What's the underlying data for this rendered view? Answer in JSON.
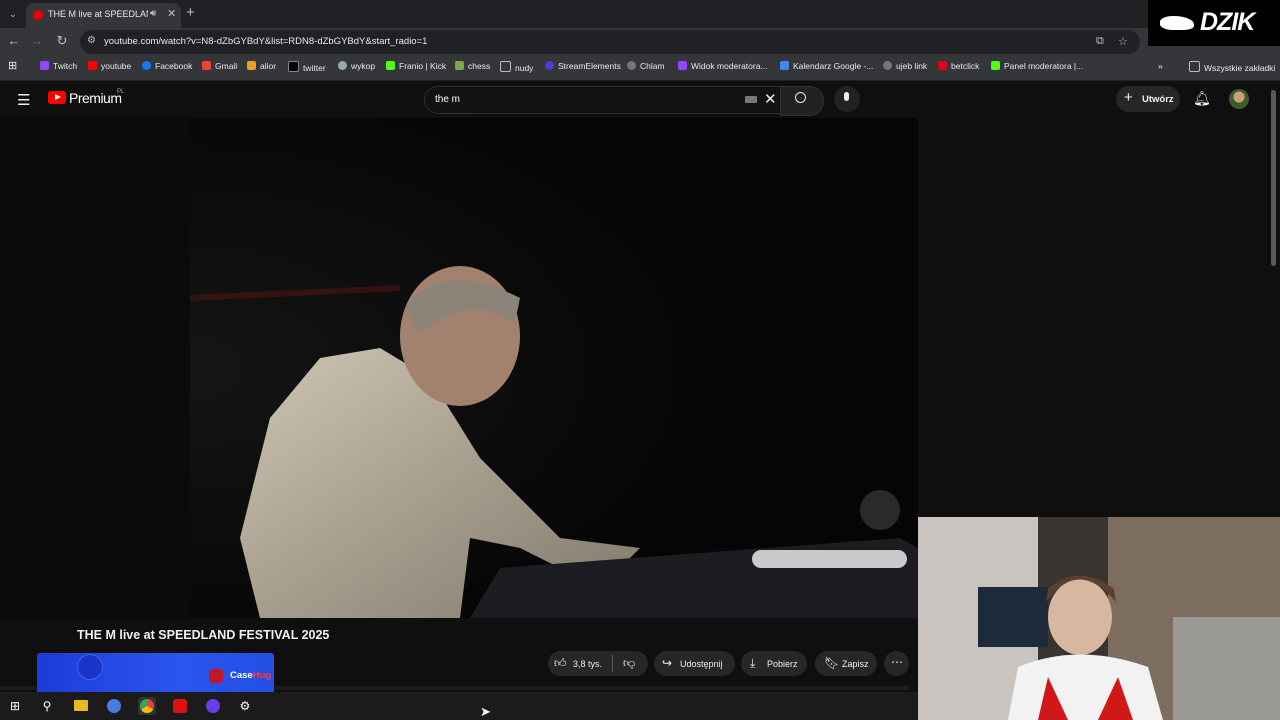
{
  "browser": {
    "tab_title": "THE M live at SPEEDLAND F",
    "url": "youtube.com/watch?v=N8-dZbGYBdY&list=RDN8-dZbGYBdY&start_radio=1",
    "bookmarks": [
      "Twitch",
      "youtube",
      "Facebook",
      "Gmail",
      "alior",
      "twitter",
      "wykop",
      "Franio | Kick",
      "chess",
      "nudy",
      "StreamElements",
      "Chlam",
      "Widok moderatora...",
      "Kalendarz Google -...",
      "ujeb link",
      "betclick",
      "Panel moderatora |..."
    ],
    "all_bookmarks": "Wszystkie zakładki"
  },
  "youtube": {
    "brand": "Premium",
    "region": "PL",
    "search_value": "the m",
    "create_label": "Utwórz",
    "video_title": "THE M live at SPEEDLAND FESTIVAL 2025",
    "likes": "3,8 tys.",
    "share": "Udostępnij",
    "download": "Pobierz",
    "save": "Zapisz"
  },
  "overlay": {
    "watermark": "DZIK",
    "ad_text_a": "Case",
    "ad_text_b": "Hug"
  },
  "colors": {
    "yt_red": "#ff0000",
    "bg": "#0f0f0f",
    "ad_blue": "#2b55f0"
  }
}
